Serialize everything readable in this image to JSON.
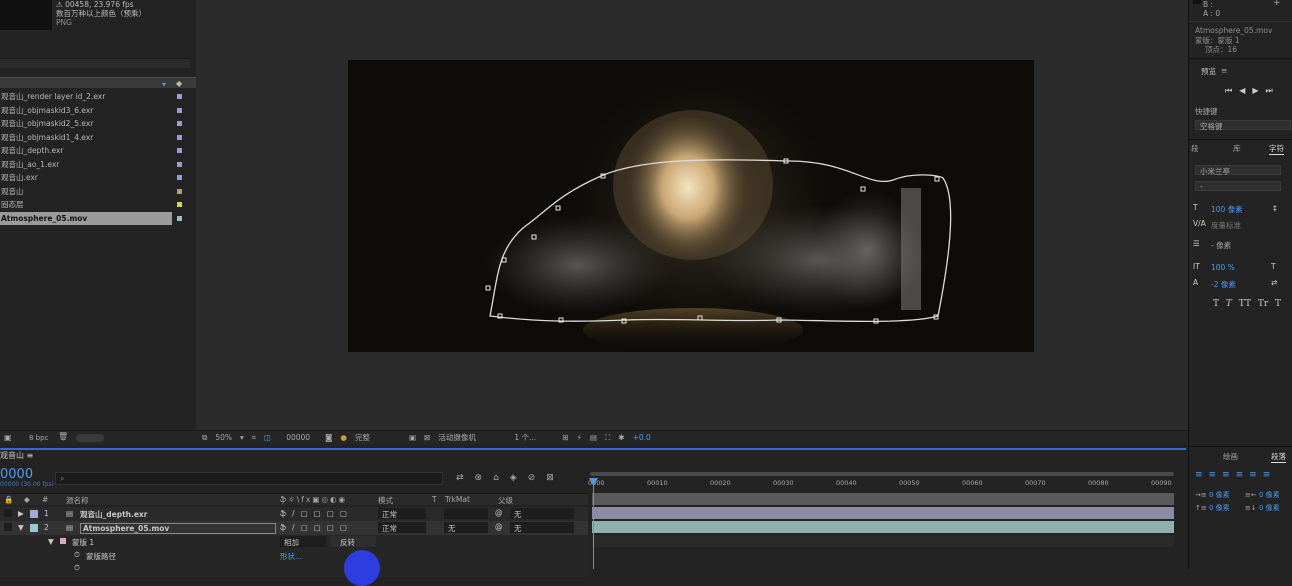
{
  "project": {
    "info_lines": [
      "⚠ 00458, 23.976 fps",
      "数百万种以上颜色（预乘）"
    ],
    "info_type": "PNG",
    "items": [
      {
        "label": "观音山_render layer id_2.exr",
        "color": "#9b9bd6"
      },
      {
        "label": "观音山_objmaskid3_6.exr",
        "color": "#9b9bd6"
      },
      {
        "label": "观音山_objmaskid2_5.exr",
        "color": "#9b9bd6"
      },
      {
        "label": "观音山_objmaskid1_4.exr",
        "color": "#9b9bd6"
      },
      {
        "label": "观音山_depth.exr",
        "color": "#9b9bd6"
      },
      {
        "label": "观音山_ao_1.exr",
        "color": "#9b9bd6"
      },
      {
        "label": "观音山.exr",
        "color": "#9b9bd6"
      },
      {
        "label": "观音山",
        "color": "#a6a66e"
      },
      {
        "label": "固态层",
        "color": "#d6d63f"
      },
      {
        "label": "Atmosphere_05.mov",
        "color": "#8fc3c3",
        "selected": true
      }
    ],
    "bpc": "8 bpc"
  },
  "viewer": {
    "zoom": "50%",
    "timecode": "00000",
    "resolution": "完整",
    "camera": "活动摄像机",
    "views": "1 个...",
    "exposure": "+0.0"
  },
  "right_panel": {
    "info_lines": [
      "B :",
      "A : 0"
    ],
    "file_info": [
      "Atmosphere_05.mov",
      "蒙版：蒙版 1",
      "顶点：16"
    ],
    "preview_title": "预览",
    "shortcut_label": "快捷键",
    "shortcut_value": "空格键",
    "tabs": [
      "段",
      "库",
      "字符"
    ],
    "font": "小米兰亭",
    "font_style": "-",
    "font_size": "100 像素",
    "tracking_label": "度量标准",
    "leading": "- 像素",
    "vscale": "100 %",
    "baseline": "-2 像素",
    "type_buttons": [
      "T",
      "T",
      "TT",
      "Tr",
      "T"
    ],
    "para_tabs": [
      "绘画",
      "段落"
    ],
    "indent_values": [
      "0 像素",
      "0 像素",
      "0 像素",
      "0 像素"
    ]
  },
  "timeline": {
    "comp_name": "观音山",
    "timecode": "0000",
    "fps": "00000 (30.00 fps)",
    "columns": {
      "source": "源名称",
      "mode": "模式",
      "t": "T",
      "trkmat": "TrkMat",
      "parent": "父级"
    },
    "layers": [
      {
        "num": "1",
        "name": "观音山_depth.exr",
        "mode": "正常",
        "trkmat": "",
        "parent": "无",
        "color": "#a8a8d8"
      },
      {
        "num": "2",
        "name": "Atmosphere_05.mov",
        "mode": "正常",
        "trkmat": "无",
        "parent": "无",
        "color": "#9ac9c9",
        "selected": true
      }
    ],
    "mask_group": "蒙版",
    "mask_name": "蒙版 1",
    "mask_mode": "相加",
    "mask_invert": "反转",
    "mask_path": "蒙版路径",
    "mask_path_value": "形状...",
    "ruler_ticks": [
      "0000",
      "00010",
      "00020",
      "00030",
      "00040",
      "00050",
      "00060",
      "00070",
      "00080",
      "00090"
    ]
  }
}
